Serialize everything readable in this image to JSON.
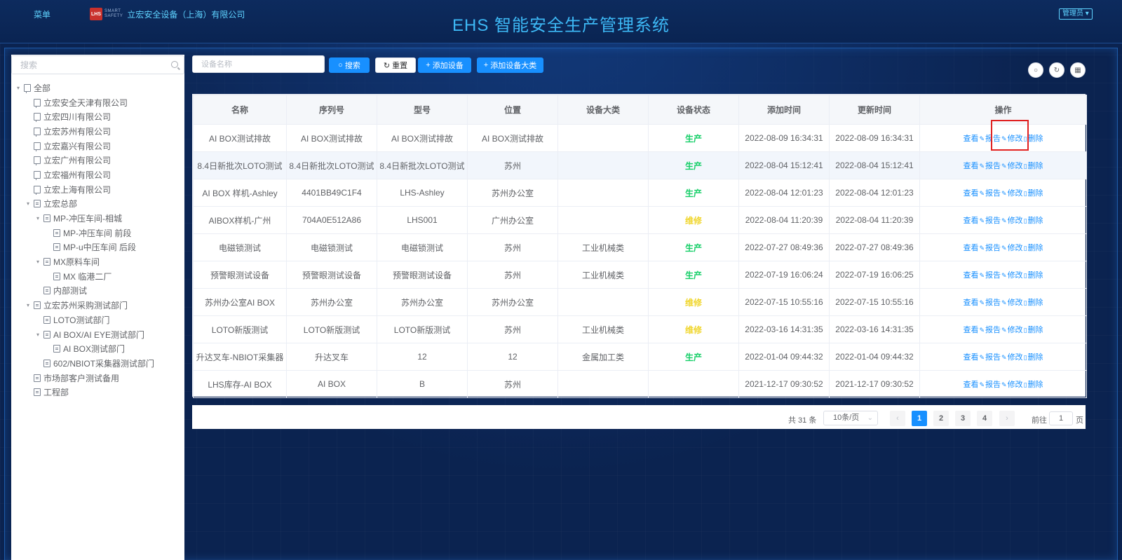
{
  "header": {
    "menu_label": "菜单",
    "logo_text": "LHS",
    "logo_sub_1": "SMART",
    "logo_sub_2": "SAFETY",
    "company": "立宏安全设备（上海）有限公司",
    "system_title": "EHS 智能安全生产管理系统",
    "user_label": "管理员"
  },
  "sidebar": {
    "search_placeholder": "搜索",
    "tree": [
      {
        "label": "全部",
        "level": 0,
        "icon": "org-icon",
        "caret": "expanded"
      },
      {
        "label": "立宏安全天津有限公司",
        "level": 1,
        "icon": "org-icon",
        "caret": "none"
      },
      {
        "label": "立宏四川有限公司",
        "level": 1,
        "icon": "org-icon",
        "caret": "none"
      },
      {
        "label": "立宏苏州有限公司",
        "level": 1,
        "icon": "org-icon",
        "caret": "none"
      },
      {
        "label": "立宏嘉兴有限公司",
        "level": 1,
        "icon": "org-icon",
        "caret": "none"
      },
      {
        "label": "立宏广州有限公司",
        "level": 1,
        "icon": "org-icon",
        "caret": "none"
      },
      {
        "label": "立宏福州有限公司",
        "level": 1,
        "icon": "org-icon",
        "caret": "none"
      },
      {
        "label": "立宏上海有限公司",
        "level": 1,
        "icon": "org-icon",
        "caret": "none"
      },
      {
        "label": "立宏总部",
        "level": 1,
        "icon": "doc-icon",
        "caret": "expanded"
      },
      {
        "label": "MP-冲压车间-相城",
        "level": 2,
        "icon": "doc-icon",
        "caret": "expanded"
      },
      {
        "label": "MP-冲压车间 前段",
        "level": 3,
        "icon": "doc-icon",
        "caret": "none"
      },
      {
        "label": "MP-u中压车间 后段",
        "level": 3,
        "icon": "doc-icon",
        "caret": "none"
      },
      {
        "label": "MX原料车间",
        "level": 2,
        "icon": "doc-icon",
        "caret": "expanded"
      },
      {
        "label": "MX 临港二厂",
        "level": 3,
        "icon": "doc-icon",
        "caret": "none"
      },
      {
        "label": "内部测试",
        "level": 2,
        "icon": "doc-icon",
        "caret": "none"
      },
      {
        "label": "立宏苏州采购测试部门",
        "level": 1,
        "icon": "doc-icon",
        "caret": "expanded"
      },
      {
        "label": "LOTO测试部门",
        "level": 2,
        "icon": "doc-icon",
        "caret": "none"
      },
      {
        "label": "AI BOX/AI EYE测试部门",
        "level": 2,
        "icon": "doc-icon",
        "caret": "expanded"
      },
      {
        "label": "AI BOX测试部门",
        "level": 3,
        "icon": "doc-icon",
        "caret": "none"
      },
      {
        "label": "602/NBIOT采集器测试部门",
        "level": 2,
        "icon": "doc-icon",
        "caret": "none"
      },
      {
        "label": "市场部客户测试备用",
        "level": 1,
        "icon": "doc-icon",
        "caret": "none"
      },
      {
        "label": "工程部",
        "level": 1,
        "icon": "doc-icon",
        "caret": "none"
      }
    ]
  },
  "toolbar": {
    "search_placeholder": "设备名称",
    "search_label": "搜索",
    "reset_label": "重置",
    "add_device_label": "添加设备",
    "add_category_label": "添加设备大类"
  },
  "table": {
    "columns": [
      "名称",
      "序列号",
      "型号",
      "位置",
      "设备大类",
      "设备状态",
      "添加时间",
      "更新时间",
      "操作"
    ],
    "ops": {
      "view": "查看",
      "report": "报告",
      "edit": "修改",
      "delete": "删除"
    },
    "rows": [
      {
        "name": "AI BOX测试排故",
        "serial": "AI BOX测试排故",
        "model": "AI BOX测试排故",
        "location": "AI BOX测试排故",
        "category": "",
        "status": "生产",
        "status_type": "green",
        "added": "2022-08-09 16:34:31",
        "updated": "2022-08-09 16:34:31"
      },
      {
        "name": "8.4日新批次LOTO测试",
        "serial": "8.4日新批次LOTO测试",
        "model": "8.4日新批次LOTO测试",
        "location": "苏州",
        "category": "",
        "status": "生产",
        "status_type": "green",
        "added": "2022-08-04 15:12:41",
        "updated": "2022-08-04 15:12:41"
      },
      {
        "name": "AI BOX 样机-Ashley",
        "serial": "4401BB49C1F4",
        "model": "LHS-Ashley",
        "location": "苏州办公室",
        "category": "",
        "status": "生产",
        "status_type": "green",
        "added": "2022-08-04 12:01:23",
        "updated": "2022-08-04 12:01:23"
      },
      {
        "name": "AIBOX样机-广州",
        "serial": "704A0E512A86",
        "model": "LHS001",
        "location": "广州办公室",
        "category": "",
        "status": "维修",
        "status_type": "yellow",
        "added": "2022-08-04 11:20:39",
        "updated": "2022-08-04 11:20:39"
      },
      {
        "name": "电磁锁测试",
        "serial": "电磁锁测试",
        "model": "电磁锁测试",
        "location": "苏州",
        "category": "工业机械类",
        "status": "生产",
        "status_type": "green",
        "added": "2022-07-27 08:49:36",
        "updated": "2022-07-27 08:49:36"
      },
      {
        "name": "预警眼测试设备",
        "serial": "预警眼测试设备",
        "model": "预警眼测试设备",
        "location": "苏州",
        "category": "工业机械类",
        "status": "生产",
        "status_type": "green",
        "added": "2022-07-19 16:06:24",
        "updated": "2022-07-19 16:06:25"
      },
      {
        "name": "苏州办公室AI BOX",
        "serial": "苏州办公室",
        "model": "苏州办公室",
        "location": "苏州办公室",
        "category": "",
        "status": "维修",
        "status_type": "yellow",
        "added": "2022-07-15 10:55:16",
        "updated": "2022-07-15 10:55:16"
      },
      {
        "name": "LOTO新版测试",
        "serial": "LOTO新版测试",
        "model": "LOTO新版测试",
        "location": "苏州",
        "category": "工业机械类",
        "status": "维修",
        "status_type": "yellow",
        "added": "2022-03-16 14:31:35",
        "updated": "2022-03-16 14:31:35"
      },
      {
        "name": "升达叉车-NBIOT采集器",
        "serial": "升达叉车",
        "model": "12",
        "location": "12",
        "category": "金属加工类",
        "status": "生产",
        "status_type": "green",
        "added": "2022-01-04 09:44:32",
        "updated": "2022-01-04 09:44:32"
      },
      {
        "name": "LHS库存-AI BOX",
        "serial": "AI BOX",
        "model": "B",
        "location": "苏州",
        "category": "",
        "status": "",
        "status_type": "none",
        "added": "2021-12-17 09:30:52",
        "updated": "2021-12-17 09:30:52"
      }
    ]
  },
  "pagination": {
    "total_text": "共 31 条",
    "page_size": "10条/页",
    "pages": [
      "1",
      "2",
      "3",
      "4"
    ],
    "current_page": "1",
    "goto_label": "前往",
    "goto_value": "1",
    "page_suffix": "页"
  },
  "colors": {
    "accent": "#1890ff",
    "status_green": "#13ce66",
    "status_yellow": "#f0d62e",
    "highlight": "#e02020",
    "background": "#0b2350"
  }
}
